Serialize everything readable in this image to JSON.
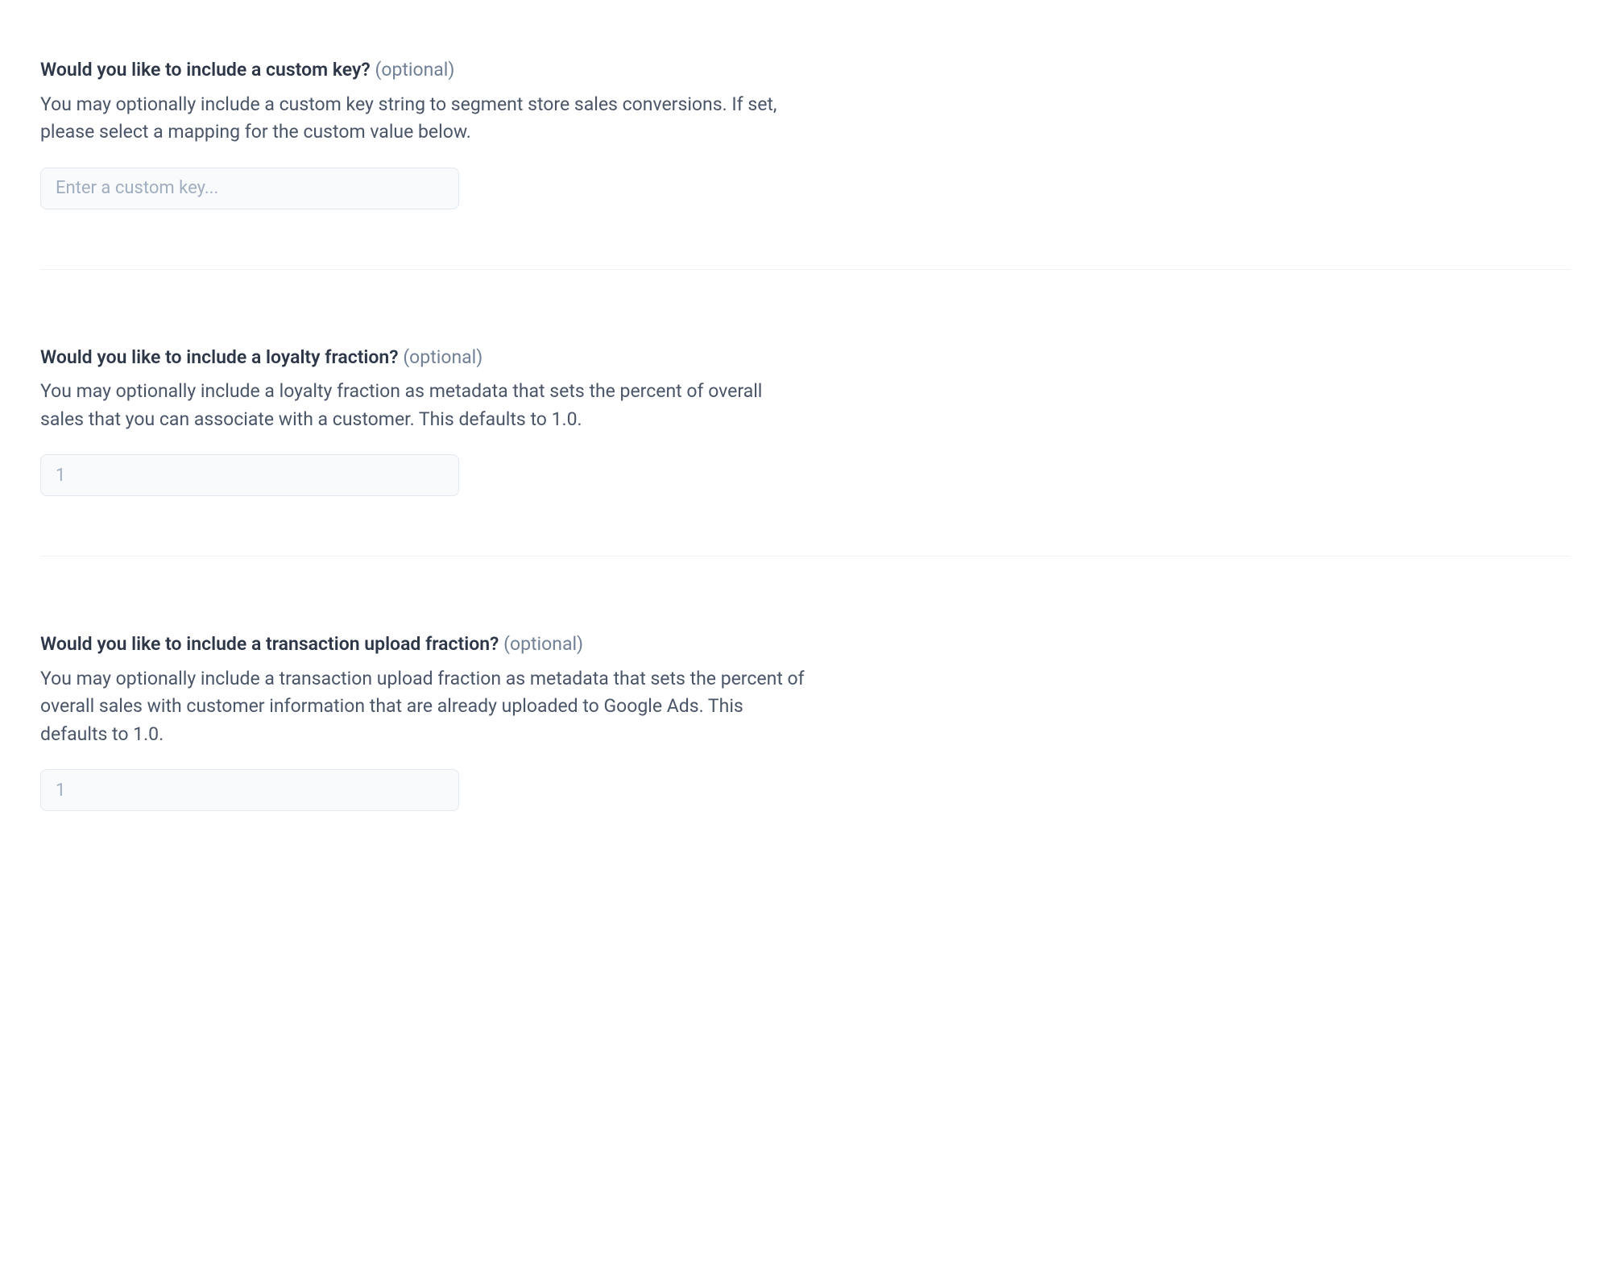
{
  "customKey": {
    "question": "Would you like to include a custom key?",
    "optional": "(optional)",
    "description": "You may optionally include a custom key string to segment store sales conversions. If set, please select a mapping for the custom value below.",
    "placeholder": "Enter a custom key..."
  },
  "loyaltyFraction": {
    "question": "Would you like to include a loyalty fraction?",
    "optional": "(optional)",
    "description": "You may optionally include a loyalty fraction as metadata that sets the percent of overall sales that you can associate with a customer. This defaults to 1.0.",
    "placeholder": "1"
  },
  "transactionFraction": {
    "question": "Would you like to include a transaction upload fraction?",
    "optional": "(optional)",
    "description": "You may optionally include a transaction upload fraction as metadata that sets the percent of overall sales with customer information that are already uploaded to Google Ads. This defaults to 1.0.",
    "placeholder": "1"
  }
}
